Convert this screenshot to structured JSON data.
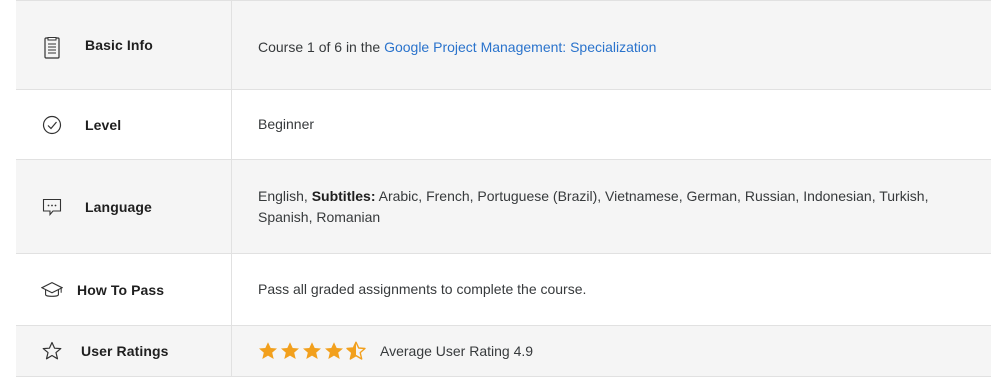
{
  "rows": {
    "basic_info": {
      "icon": "document-icon",
      "label": "Basic Info",
      "value_prefix": "Course 1 of 6 in the ",
      "value_link": "Google Project Management: Specialization"
    },
    "level": {
      "icon": "check-circle-icon",
      "label": "Level",
      "value": "Beginner"
    },
    "language": {
      "icon": "chat-bubble-icon",
      "label": "Language",
      "value_primary": "English, ",
      "subtitles_label": "Subtitles:",
      "value_subtitles": " Arabic, French, Portuguese (Brazil), Vietnamese, German, Russian, Indonesian, Turkish, Spanish, Romanian"
    },
    "how_to_pass": {
      "icon": "graduation-cap-icon",
      "label": "How To Pass",
      "value": "Pass all graded assignments to complete the course."
    },
    "user_ratings": {
      "icon": "star-outline-icon",
      "label": "User Ratings",
      "rating": 4.9,
      "value": "Average User Rating 4.9"
    }
  },
  "colors": {
    "star": "#f2a01d",
    "link": "#2a73cc",
    "row_alt": "#f5f5f5"
  }
}
